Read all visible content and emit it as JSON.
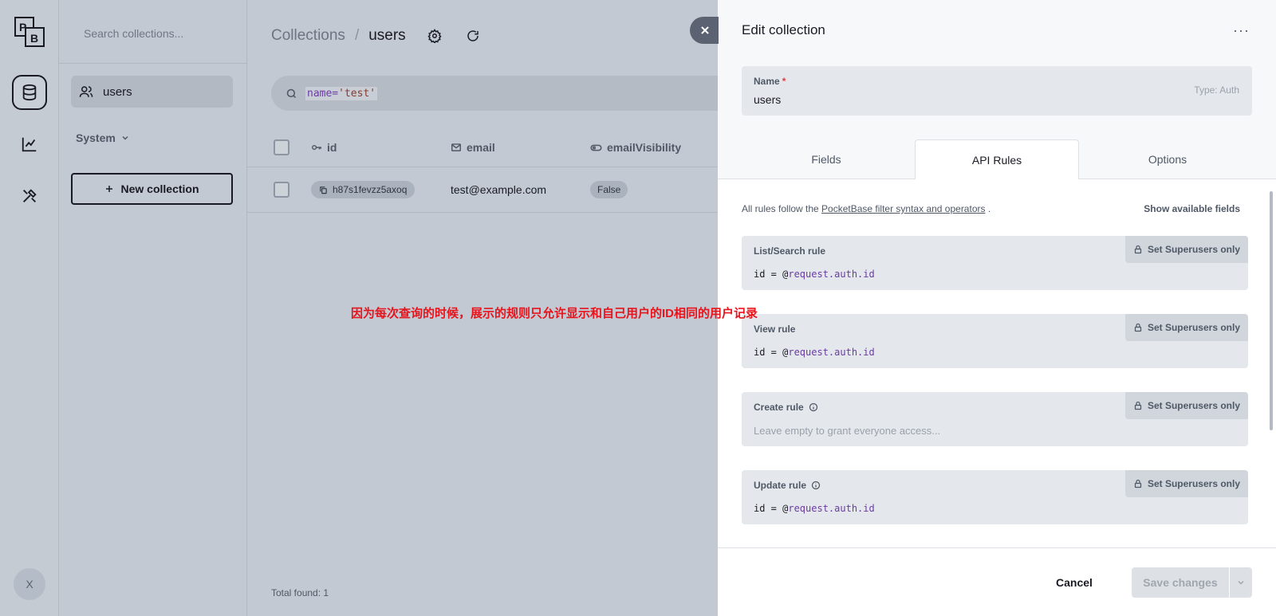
{
  "rail": {
    "logo_letters": [
      "P",
      "B"
    ],
    "avatar_letter": "X"
  },
  "sidebar": {
    "search_placeholder": "Search collections...",
    "collections": [
      {
        "label": "users",
        "icon": "users-icon"
      }
    ],
    "system_label": "System",
    "new_collection_label": "New collection"
  },
  "main": {
    "breadcrumb": {
      "root": "Collections",
      "separator": "/",
      "current": "users"
    },
    "filter": {
      "key": "name=",
      "value": "'test'"
    },
    "columns": [
      {
        "label": "id",
        "icon": "key-icon"
      },
      {
        "label": "email",
        "icon": "mail-icon"
      },
      {
        "label": "emailVisibility",
        "icon": "toggle-icon"
      }
    ],
    "rows": [
      {
        "id": "h87s1fevzz5axoq",
        "email": "test@example.com",
        "emailVisibility": "False"
      }
    ],
    "total_label": "Total found:",
    "total_value": "1"
  },
  "annotation": "因为每次查询的时候，展示的规则只允许显示和自己用户的ID相同的用户记录",
  "panel": {
    "title": "Edit collection",
    "more": "···",
    "name_label": "Name",
    "name_required": "*",
    "name_value": "users",
    "type_label": "Type: Auth",
    "tabs": [
      "Fields",
      "API Rules",
      "Options"
    ],
    "active_tab": "API Rules",
    "info_prefix": "All rules follow the ",
    "info_link": "PocketBase filter syntax and operators",
    "info_suffix": " .",
    "show_fields": "Show available fields",
    "superusers_label": "Set Superusers only",
    "rules": [
      {
        "label": "List/Search rule",
        "value_plain": "id = @",
        "value_var": "request.auth.id",
        "placeholder": ""
      },
      {
        "label": "View rule",
        "value_plain": "id = @",
        "value_var": "request.auth.id",
        "placeholder": ""
      },
      {
        "label": "Create rule",
        "value_plain": "",
        "value_var": "",
        "placeholder": "Leave empty to grant everyone access..."
      },
      {
        "label": "Update rule",
        "value_plain": "id = @",
        "value_var": "request.auth.id",
        "placeholder": ""
      }
    ],
    "cancel_label": "Cancel",
    "save_label": "Save changes"
  },
  "colors": {
    "overlay_bg": "#c3c9d2",
    "panel_bg": "#f7f8f9",
    "annotation": "#e8141c",
    "code_variable": "#6b3aa5"
  }
}
